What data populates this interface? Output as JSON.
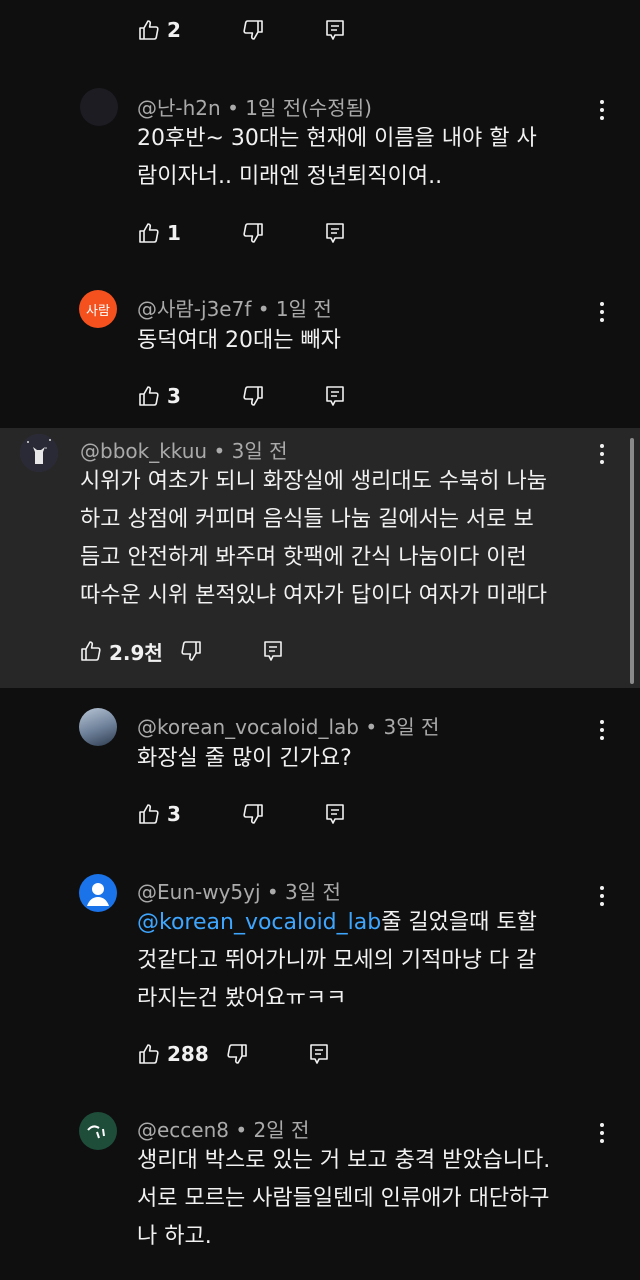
{
  "comments": [
    {
      "like_count": "2"
    },
    {
      "handle": "@난-h2n",
      "time": "• 1일 전(수정됨)",
      "lines": [
        "20후반~ 30대는 현재에 이름을 내야 할 사",
        "람이자너.. 미래엔 정년퇴직이여.."
      ],
      "like_count": "1"
    },
    {
      "handle": "@사람-j3e7f",
      "time": "• 1일 전",
      "avatar_text": "사람",
      "avatar_color": "#f4511e",
      "lines": [
        "동덕여대 20대는 빼자"
      ],
      "like_count": "3"
    },
    {
      "handle": "@bbok_kkuu",
      "time": "• 3일 전",
      "lines": [
        "시위가 여초가 되니 화장실에 생리대도 수북히 나눔",
        "하고 상점에 커피며 음식들 나눔 길에서는 서로 보",
        "듬고 안전하게 봐주며 핫팩에 간식 나눔이다 이런",
        "따수운 시위 본적있냐 여자가 답이다 여자가 미래다"
      ],
      "like_count": "2.9천"
    },
    {
      "handle": "@korean_vocaloid_lab",
      "time": "• 3일 전",
      "lines": [
        "화장실 줄 많이 긴가요?"
      ],
      "like_count": "3"
    },
    {
      "handle": "@Eun-wy5yj",
      "time": "• 3일 전",
      "mention": "@korean_vocaloid_lab",
      "lines": [
        "줄 길었을때 토할",
        "것같다고 뛰어가니까 모세의 기적마냥 다 갈",
        "라지는건 봤어요ㅠㅋㅋ"
      ],
      "like_count": "288",
      "avatar_color": "#1a73e8"
    },
    {
      "handle": "@eccen8",
      "time": "• 2일 전",
      "lines": [
        "생리대 박스로 있는 거 보고 충격 받았습니다.",
        "서로 모르는 사람들일텐데 인류애가 대단하구",
        "나 하고."
      ],
      "avatar_color": "#1e4d3a"
    }
  ],
  "icons": {
    "like": "thumbs-up-icon",
    "dislike": "thumbs-down-icon",
    "reply": "reply-icon",
    "more": "more-vert-icon"
  }
}
